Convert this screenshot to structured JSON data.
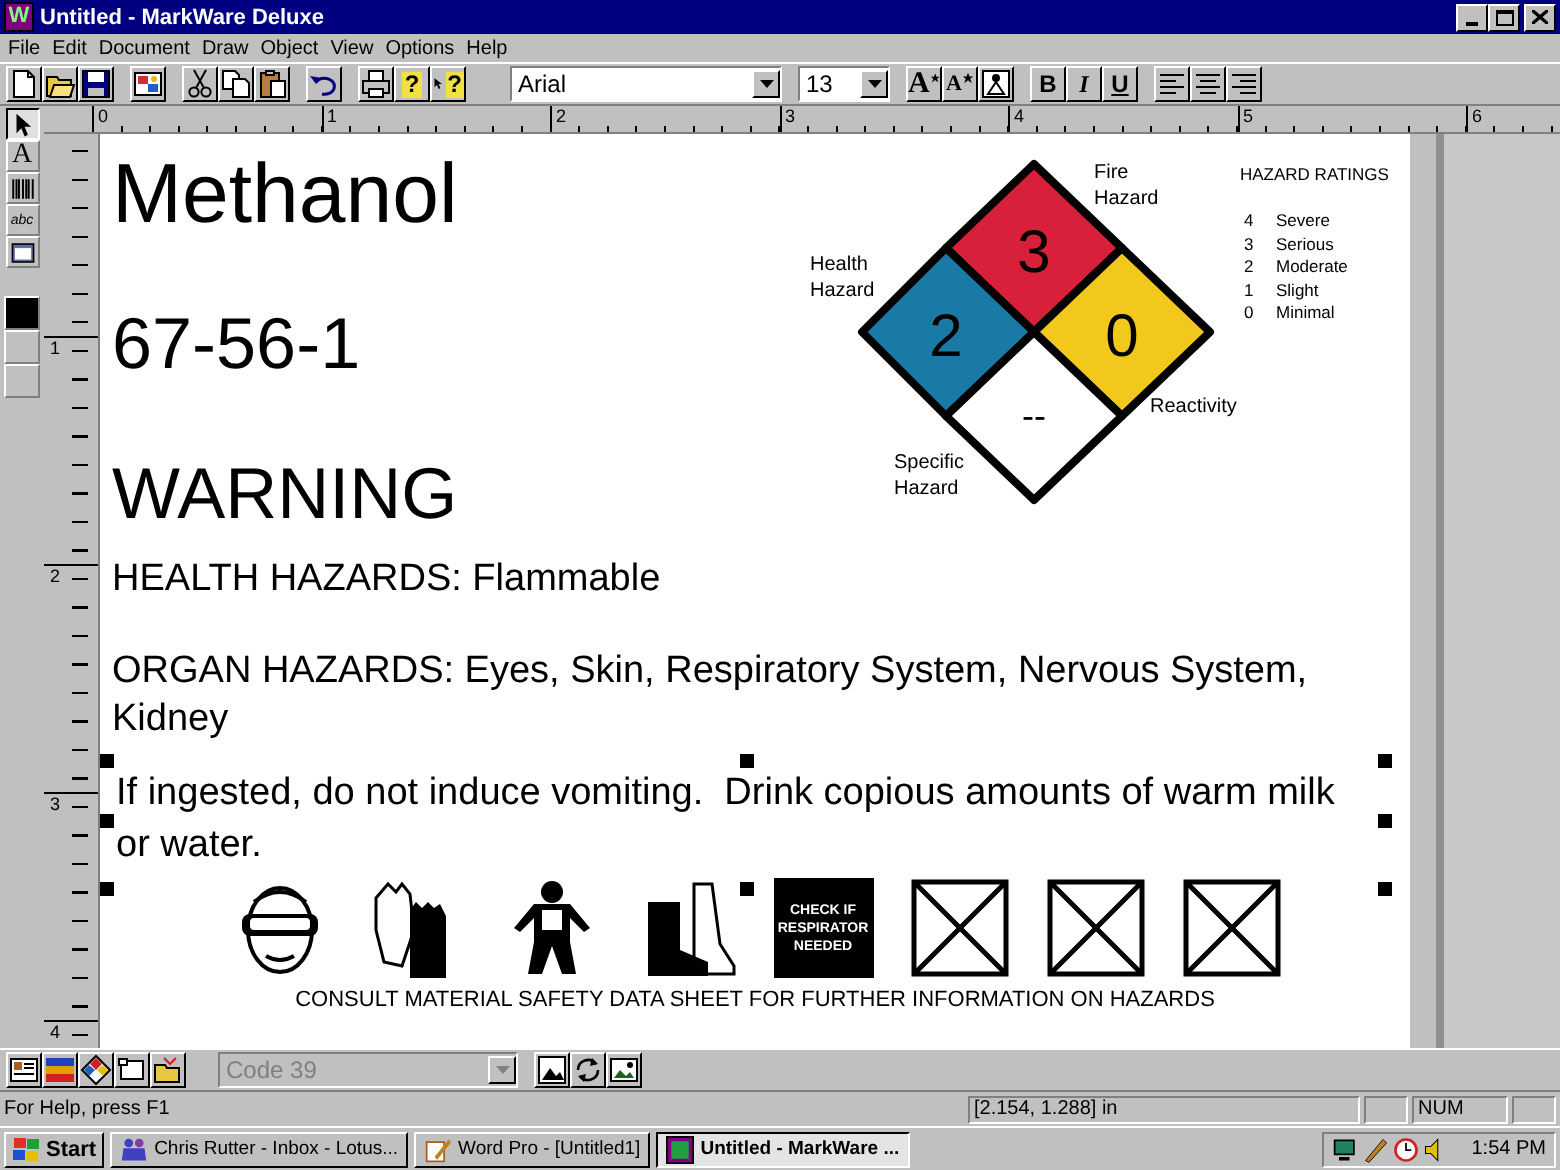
{
  "window": {
    "title": "Untitled - MarkWare Deluxe",
    "icon_letter": "W"
  },
  "menu": [
    "File",
    "Edit",
    "Document",
    "Draw",
    "Object",
    "View",
    "Options",
    "Help"
  ],
  "toolbar": {
    "left_groups": [
      [
        {
          "kind": "new"
        },
        {
          "kind": "open"
        },
        {
          "kind": "save"
        }
      ],
      [
        {
          "kind": "wizard"
        }
      ],
      [
        {
          "kind": "cut"
        },
        {
          "kind": "copy"
        },
        {
          "kind": "paste"
        }
      ],
      [
        {
          "kind": "undo"
        }
      ],
      [
        {
          "kind": "print"
        },
        {
          "kind": "help",
          "label": "?"
        },
        {
          "kind": "context-help",
          "label": "?"
        }
      ]
    ],
    "font": "Arial",
    "size": "13",
    "right_groups": [
      [
        {
          "kind": "grow",
          "label": "A"
        },
        {
          "kind": "shrink",
          "label": "A"
        },
        {
          "kind": "symbol"
        }
      ],
      [
        {
          "kind": "bold",
          "label": "B"
        },
        {
          "kind": "italic",
          "label": "I"
        },
        {
          "kind": "underline",
          "label": "U"
        }
      ],
      [
        {
          "kind": "align-left"
        },
        {
          "kind": "align-center"
        },
        {
          "kind": "align-right"
        }
      ]
    ]
  },
  "palette": {
    "tools": [
      {
        "kind": "pointer",
        "selected": true
      },
      {
        "kind": "text",
        "label": "A",
        "selected": false
      },
      {
        "kind": "barcode",
        "selected": false
      },
      {
        "kind": "curve-text",
        "label": "abc",
        "selected": false
      },
      {
        "kind": "image",
        "selected": false
      }
    ],
    "swatches": [
      {
        "color": "#000000"
      },
      {
        "color": "#c0c0c0"
      },
      {
        "color": "#c0c0c0"
      }
    ]
  },
  "rulers": {
    "horizontal": [
      "0",
      "1",
      "2",
      "3",
      "4",
      "5",
      "6"
    ],
    "vertical": [
      "1",
      "2",
      "3",
      "4"
    ]
  },
  "label": {
    "chemical": "Methanol",
    "cas_number": "67-56-1",
    "signal_word": "WARNING",
    "health_hazards": "HEALTH HAZARDS: Flammable",
    "organ_hazards": "ORGAN HAZARDS: Eyes, Skin, Respiratory System, Nervous System, Kidney",
    "instructions": {
      "text": "If ingested, do not induce vomiting.  Drink copious amounts of warm milk or water.",
      "selected": true
    },
    "hazard_diamond": {
      "quadrants": [
        {
          "kind": "fire",
          "value": "3",
          "label": [
            "Fire",
            "Hazard"
          ]
        },
        {
          "kind": "health",
          "value": "2",
          "label": [
            "Health",
            "Hazard"
          ]
        },
        {
          "kind": "reactivity",
          "value": "0",
          "label": [
            "Reactivity"
          ]
        },
        {
          "kind": "specific",
          "value": "--",
          "label": [
            "Specific",
            "Hazard"
          ]
        }
      ]
    },
    "hazard_ratings": {
      "title": "HAZARD RATINGS",
      "items": [
        {
          "value": "4",
          "label": "Severe"
        },
        {
          "value": "3",
          "label": "Serious"
        },
        {
          "value": "2",
          "label": "Moderate"
        },
        {
          "value": "1",
          "label": "Slight"
        },
        {
          "value": "0",
          "label": "Minimal"
        }
      ]
    },
    "ppe": [
      {
        "kind": "goggles"
      },
      {
        "kind": "gloves"
      },
      {
        "kind": "suit"
      },
      {
        "kind": "boots"
      },
      {
        "kind": "respirator",
        "text": "CHECK IF RESPIRATOR NEEDED"
      },
      {
        "kind": "empty"
      },
      {
        "kind": "empty"
      },
      {
        "kind": "empty"
      }
    ],
    "footer": "CONSULT MATERIAL SAFETY DATA SHEET FOR FURTHER INFORMATION ON HAZARDS"
  },
  "bottom_toolbar": {
    "left": [
      {
        "kind": "card"
      },
      {
        "kind": "colors"
      },
      {
        "kind": "diamond"
      },
      {
        "kind": "frame"
      },
      {
        "kind": "open-image"
      }
    ],
    "barcode_type": {
      "value": "Code 39",
      "disabled": true
    },
    "right": [
      {
        "kind": "rotate-image"
      },
      {
        "kind": "refresh"
      },
      {
        "kind": "edit-image"
      }
    ]
  },
  "status_bar": {
    "help": "For Help, press F1",
    "position": "[2.154, 1.288] in",
    "num": "NUM"
  },
  "taskbar": {
    "start": "Start",
    "tasks": [
      {
        "kind": "mail",
        "label": "Chris Rutter - Inbox - Lotus...",
        "selected": false
      },
      {
        "kind": "writer",
        "label": "Word Pro - [Untitled1]",
        "selected": false
      },
      {
        "kind": "app",
        "label": "Untitled - MarkWare ...",
        "selected": true
      }
    ],
    "clock": "1:54 PM"
  }
}
